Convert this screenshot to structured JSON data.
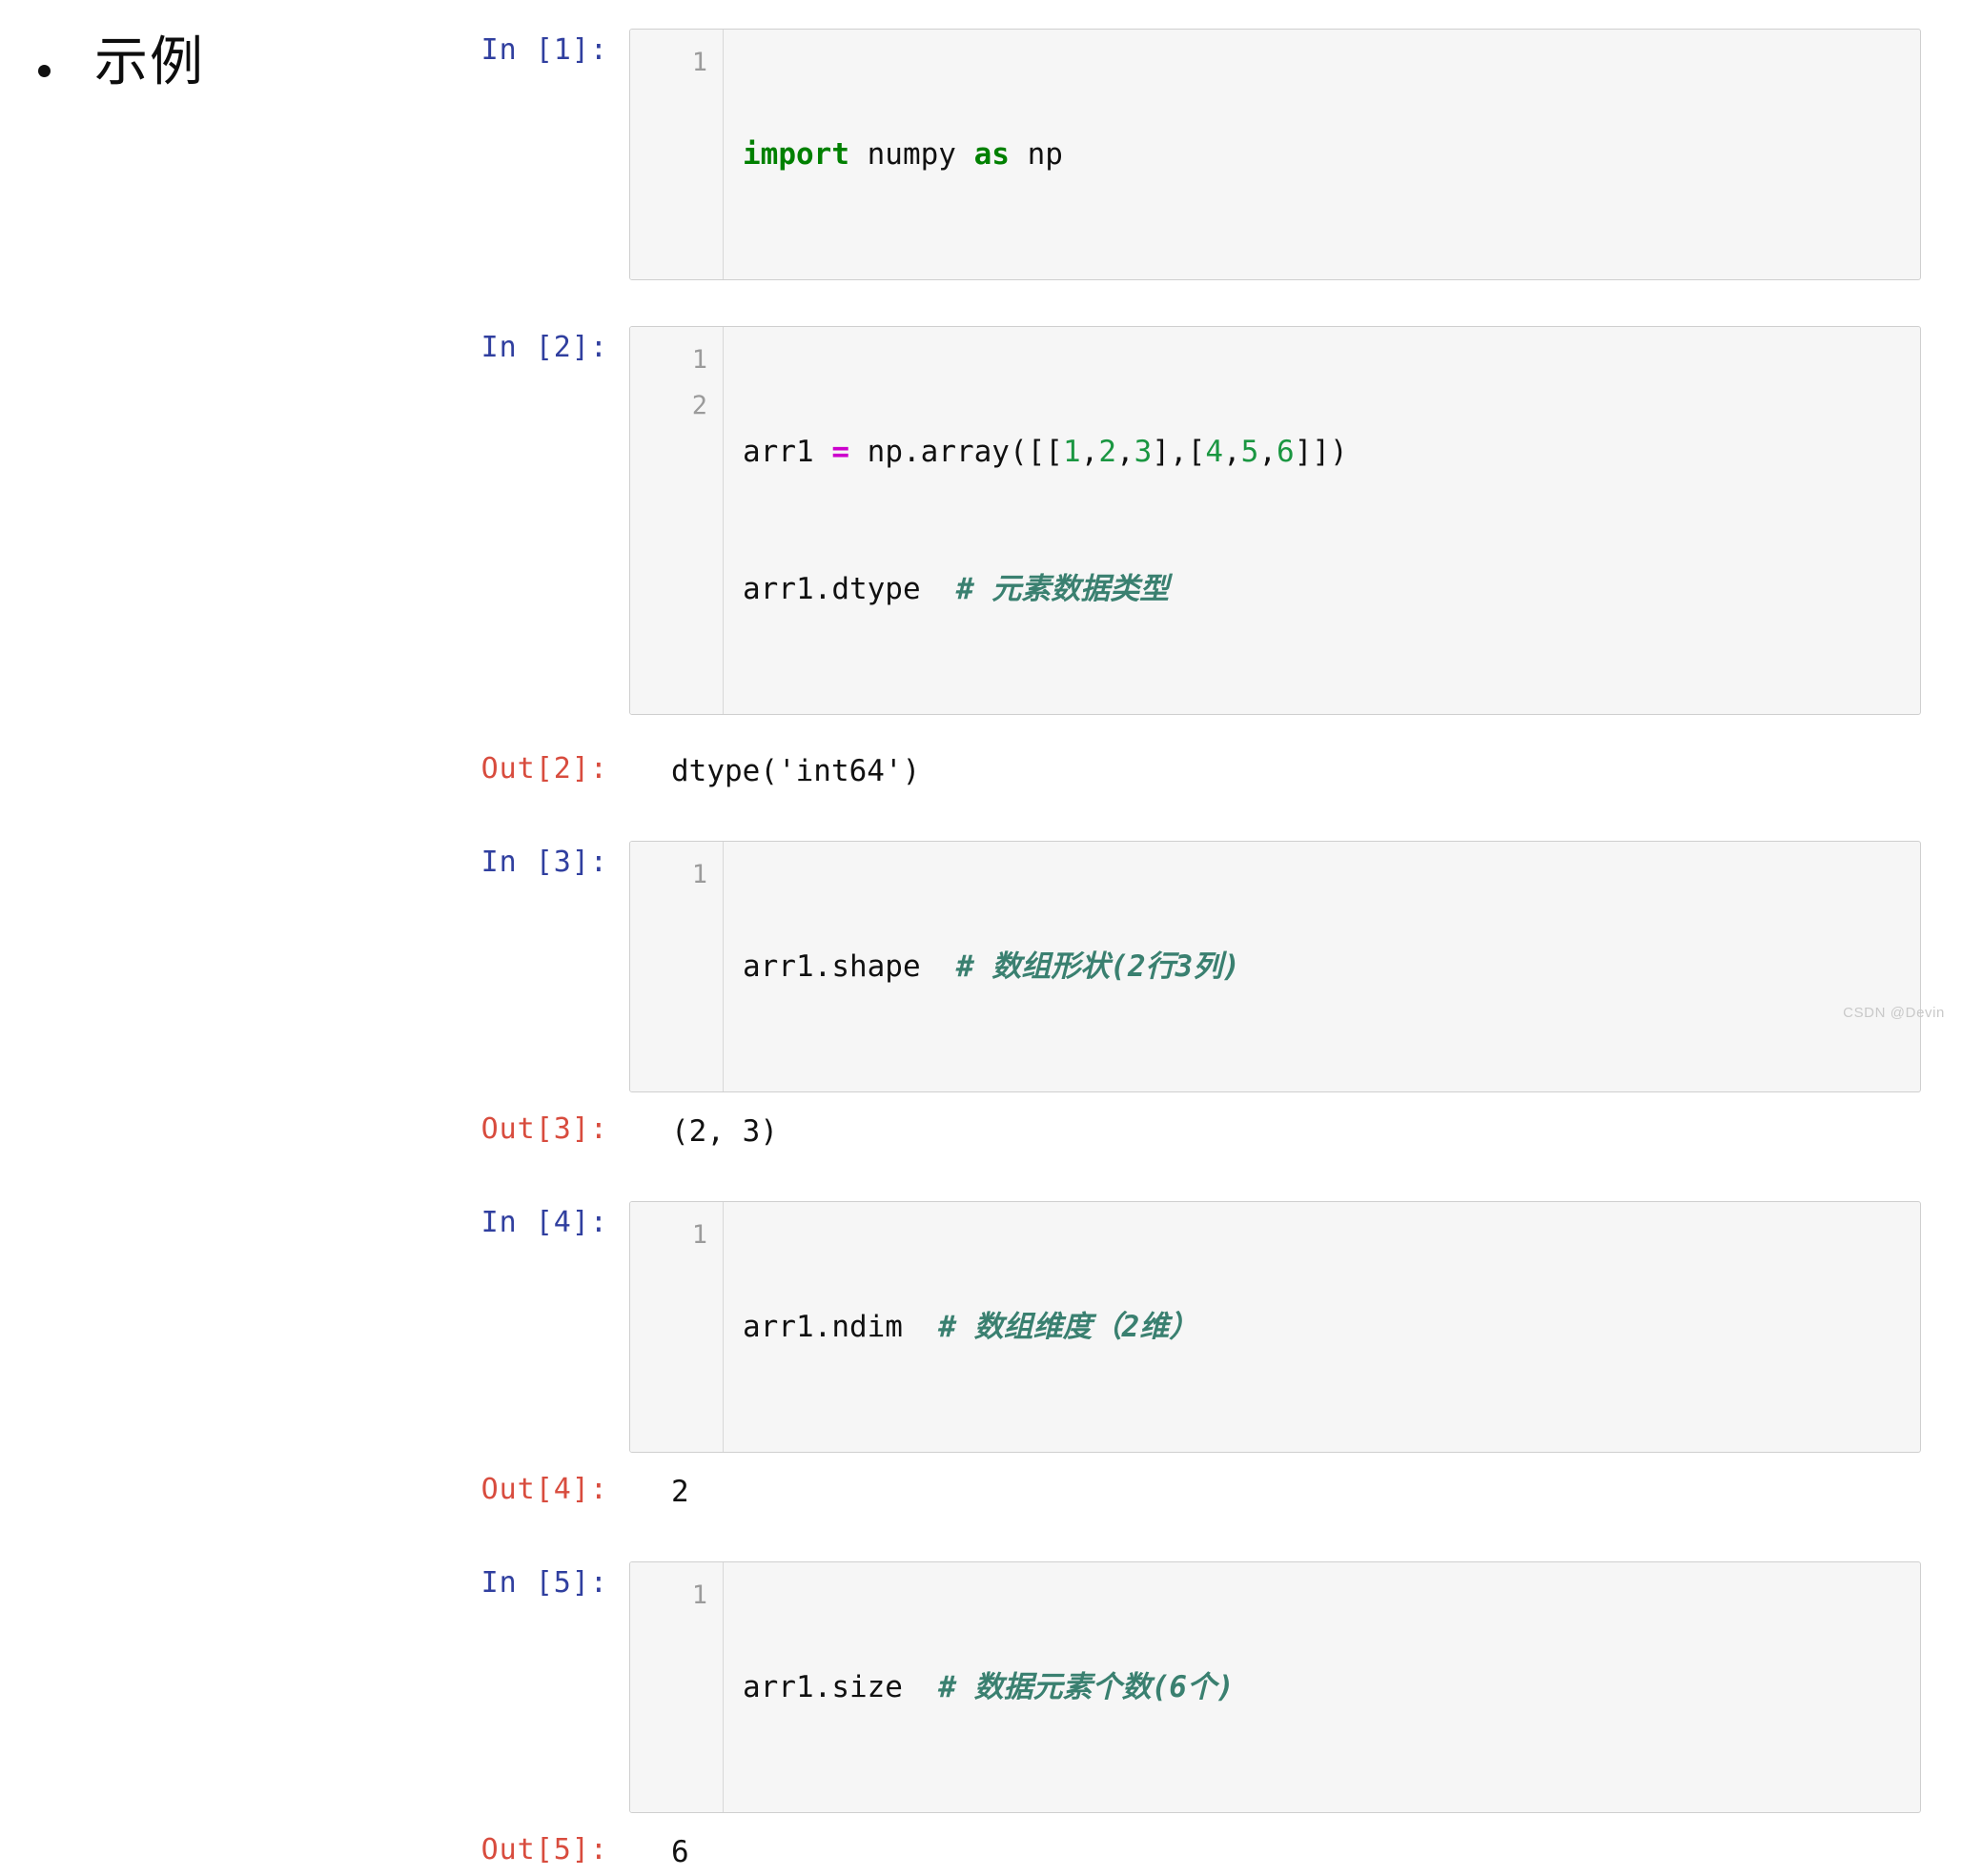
{
  "slide": {
    "bullet_icon": "bullet-dot-icon",
    "heading": "示例"
  },
  "notebook": {
    "cells": [
      {
        "type": "input",
        "prompt": "In [1]:",
        "lines": [
          {
            "number": "1",
            "text": "import numpy as np"
          }
        ]
      },
      {
        "type": "input",
        "prompt": "In [2]:",
        "lines": [
          {
            "number": "1",
            "text": "arr1 = np.array([[1,2,3],[4,5,6]])"
          },
          {
            "number": "2",
            "text": "arr1.dtype  # 元素数据类型"
          }
        ]
      },
      {
        "type": "output",
        "prompt": "Out[2]:",
        "text": "dtype('int64')"
      },
      {
        "type": "input",
        "prompt": "In [3]:",
        "lines": [
          {
            "number": "1",
            "text": "arr1.shape  # 数组形状(2行3列)"
          }
        ]
      },
      {
        "type": "output",
        "prompt": "Out[3]:",
        "text": "(2, 3)"
      },
      {
        "type": "input",
        "prompt": "In [4]:",
        "lines": [
          {
            "number": "1",
            "text": "arr1.ndim  # 数组维度（2维）"
          }
        ]
      },
      {
        "type": "output",
        "prompt": "Out[4]:",
        "text": "2"
      },
      {
        "type": "input",
        "prompt": "In [5]:",
        "lines": [
          {
            "number": "1",
            "text": "arr1.size  # 数据元素个数(6个)"
          }
        ]
      },
      {
        "type": "output",
        "prompt": "Out[5]:",
        "text": "6"
      }
    ],
    "code_tokens": {
      "cell1_line1": [
        {
          "t": "import",
          "c": "kw"
        },
        {
          "t": " numpy ",
          "c": "pl"
        },
        {
          "t": "as",
          "c": "kw"
        },
        {
          "t": " np",
          "c": "pl"
        }
      ],
      "cell2_line1": [
        {
          "t": "arr1 ",
          "c": "pl"
        },
        {
          "t": "=",
          "c": "op"
        },
        {
          "t": " np.array([[",
          "c": "pl"
        },
        {
          "t": "1",
          "c": "num"
        },
        {
          "t": ",",
          "c": "pl"
        },
        {
          "t": "2",
          "c": "num"
        },
        {
          "t": ",",
          "c": "pl"
        },
        {
          "t": "3",
          "c": "num"
        },
        {
          "t": "],[",
          "c": "pl"
        },
        {
          "t": "4",
          "c": "num"
        },
        {
          "t": ",",
          "c": "pl"
        },
        {
          "t": "5",
          "c": "num"
        },
        {
          "t": ",",
          "c": "pl"
        },
        {
          "t": "6",
          "c": "num"
        },
        {
          "t": "]])",
          "c": "pl"
        }
      ],
      "cell2_line2": [
        {
          "t": "arr1.dtype  ",
          "c": "pl"
        },
        {
          "t": "# 元素数据类型",
          "c": "cm"
        }
      ],
      "cell3_line1": [
        {
          "t": "arr1.shape  ",
          "c": "pl"
        },
        {
          "t": "# 数组形状(2行3列)",
          "c": "cm"
        }
      ],
      "cell4_line1": [
        {
          "t": "arr1.ndim  ",
          "c": "pl"
        },
        {
          "t": "# 数组维度（2维）",
          "c": "cm"
        }
      ],
      "cell5_line1": [
        {
          "t": "arr1.size  ",
          "c": "pl"
        },
        {
          "t": "# 数据元素个数(6个)",
          "c": "cm"
        }
      ]
    }
  },
  "watermark": "CSDN @Devin",
  "colors": {
    "prompt_in": "#303f9f",
    "prompt_out": "#d84c3e",
    "keyword": "#008000",
    "number": "#1a9641",
    "operator": "#cc00cc",
    "comment": "#3a8070",
    "cell_bg": "#f6f6f6",
    "cell_border": "#cfcfcf"
  }
}
